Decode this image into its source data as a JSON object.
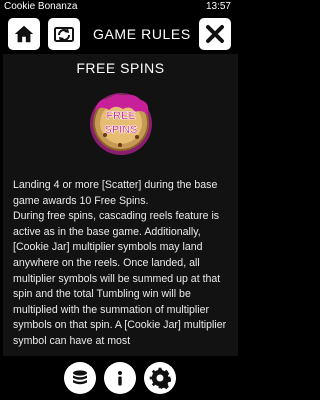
{
  "status": {
    "app_name": "Cookie Bonanza",
    "time": "13:57"
  },
  "header": {
    "title": "GAME RULES"
  },
  "section": {
    "title": "FREE SPINS",
    "symbol_text": [
      "FREE",
      "SPINS"
    ],
    "paragraphs": [
      "Landing 4 or more [Scatter] during the base game awards 10 Free Spins.",
      "During free spins, cascading reels feature is active as in the base game. Additionally, [Cookie Jar] multiplier symbols may land anywhere on the reels. Once landed, all multiplier symbols will be summed up at that spin and the total Tumbling win will be multiplied with the summation of multiplier symbols on that spin. A [Cookie Jar] multiplier symbol can have at most"
    ]
  },
  "footer": {
    "icons": [
      "coin-stack-icon",
      "info-icon",
      "gear-icon"
    ]
  },
  "colors": {
    "background": "#000000",
    "panel": "#121212",
    "button": "#ffffff",
    "icon": "#111111",
    "cookie": "#c69a54",
    "frosting": "#c8209a"
  }
}
